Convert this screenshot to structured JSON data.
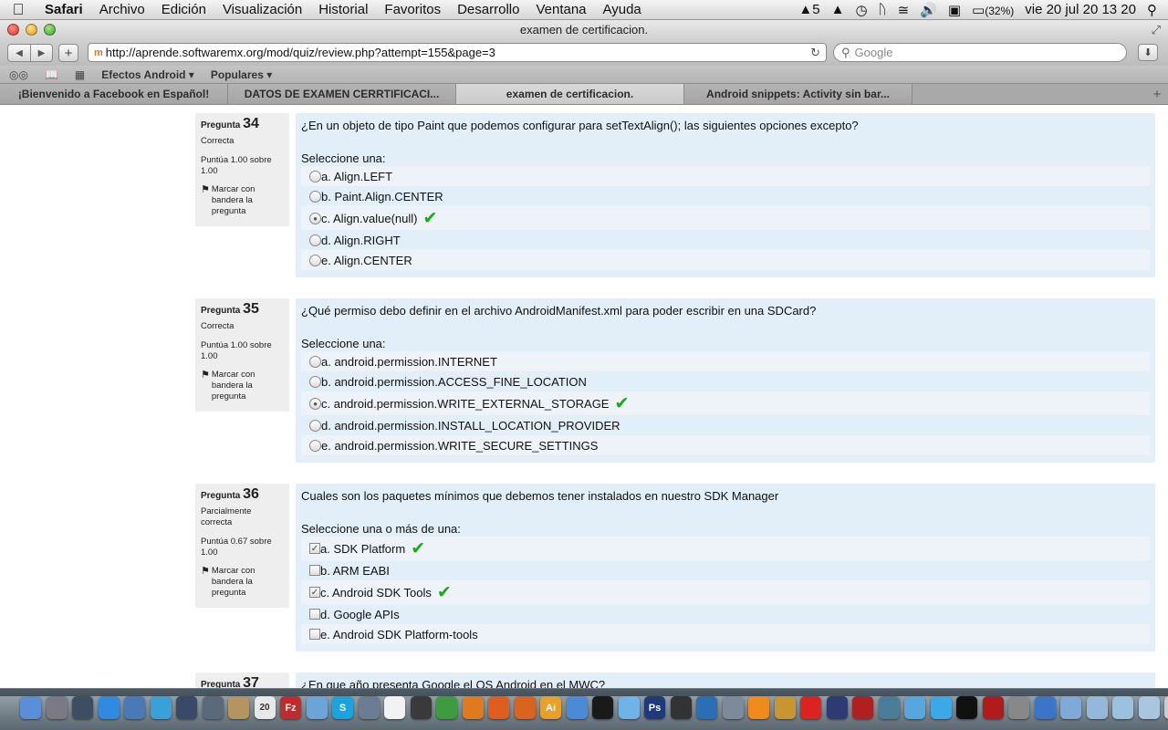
{
  "menubar": {
    "app": "Safari",
    "menus": [
      "Archivo",
      "Edición",
      "Visualización",
      "Historial",
      "Favoritos",
      "Desarrollo",
      "Ventana",
      "Ayuda"
    ],
    "status_num": "5",
    "battery": "(32%)",
    "clock": "vie 20 jul  20 13 20"
  },
  "window": {
    "title": "examen de certificacion.",
    "url": "http://aprende.softwaremx.org/mod/quiz/review.php?attempt=155&page=3",
    "search_placeholder": "Google"
  },
  "bookmarks": [
    "Efectos Android ▾",
    "Populares ▾"
  ],
  "tabs": [
    {
      "label": "¡Bienvenido a Facebook en Español!",
      "active": false
    },
    {
      "label": "DATOS DE EXAMEN CERRTIFICACI...",
      "active": false
    },
    {
      "label": "examen de certificacion.",
      "active": true
    },
    {
      "label": "Android snippets: Activity sin bar...",
      "active": false
    }
  ],
  "common": {
    "pregunta": "Pregunta",
    "flag_text": "Marcar con bandera la pregunta"
  },
  "questions": [
    {
      "number": "34",
      "state": "Correcta",
      "grade": "Puntúa 1.00 sobre 1.00",
      "text": "¿En un objeto de tipo Paint que podemos configurar para setTextAlign(); las siguientes opciones excepto?",
      "prompt": "Seleccione una:",
      "type": "radio",
      "options": [
        {
          "label": "a. Align.LEFT"
        },
        {
          "label": "b. Paint.Align.CENTER"
        },
        {
          "label": "c. Align.value(null)"
        },
        {
          "label": "d. Align.RIGHT"
        },
        {
          "label": "e. Align.CENTER"
        }
      ]
    },
    {
      "number": "35",
      "state": "Correcta",
      "grade": "Puntúa 1.00 sobre 1.00",
      "text": "¿Qué permiso debo definir en el archivo AndroidManifest.xml para poder escribir en una SDCard?",
      "prompt": "Seleccione una:",
      "type": "radio",
      "options": [
        {
          "label": "a. android.permission.INTERNET"
        },
        {
          "label": "b. android.permission.ACCESS_FINE_LOCATION"
        },
        {
          "label": "c. android.permission.WRITE_EXTERNAL_STORAGE"
        },
        {
          "label": "d. android.permission.INSTALL_LOCATION_PROVIDER"
        },
        {
          "label": "e. android.permission.WRITE_SECURE_SETTINGS"
        }
      ]
    },
    {
      "number": "36",
      "state": "Parcialmente correcta",
      "grade": "Puntúa 0.67 sobre 1.00",
      "text": "Cuales son los paquetes mínimos que debemos tener instalados en nuestro SDK Manager",
      "prompt": "Seleccione una o más de una:",
      "type": "checkbox",
      "options": [
        {
          "label": "a. SDK Platform"
        },
        {
          "label": "b. ARM EABI"
        },
        {
          "label": "c. Android SDK Tools"
        },
        {
          "label": "d. Google APIs"
        },
        {
          "label": "e. Android SDK Platform-tools"
        }
      ]
    },
    {
      "number": "37",
      "text": "¿En que año presenta Google el OS Android en el MWC?"
    }
  ],
  "state": {
    "q34_selected": "c",
    "q34_correct": [
      "c"
    ],
    "q35_selected": "c",
    "q35_correct": [
      "c"
    ],
    "q36_selected": [
      "a",
      "c"
    ],
    "q36_correct": [
      "a",
      "c"
    ]
  },
  "dock": {
    "icons": [
      "finder-icon",
      "launchpad-icon",
      "mission-control-icon",
      "app-store-icon",
      "preview-icon",
      "safari-icon",
      "quicktime-icon",
      "x11-icon",
      "address-book-icon",
      "ical-icon",
      "filezilla-icon",
      "virtualbox-cube-icon",
      "skype-icon",
      "xcode-icon",
      "textedit-icon",
      "photo-booth-icon",
      "android-icon",
      "blender-icon",
      "firefox-icon",
      "firefox-alt-icon",
      "illustrator-icon",
      "cyberduck-icon",
      "cinema-icon",
      "photo-icon",
      "photoshop-icon",
      "unity-icon",
      "virtualbox-icon",
      "dashcode-icon",
      "vlc-icon",
      "puzzle-icon",
      "angry-birds-icon",
      "eclipse-icon",
      "utility-icon",
      "activity-icon",
      "itunes-icon",
      "twitter-icon",
      "terminal-icon",
      "flash-icon",
      "system-prefs-icon",
      "xcode-tools-icon",
      "folder-icon",
      "documents-icon",
      "downloads-icon",
      "applications-icon",
      "trash-icon"
    ],
    "labels": {
      "filezilla": "Fz",
      "skype": "S",
      "photoshop": "Ps",
      "illustrator": "Ai",
      "ical": "20"
    }
  }
}
